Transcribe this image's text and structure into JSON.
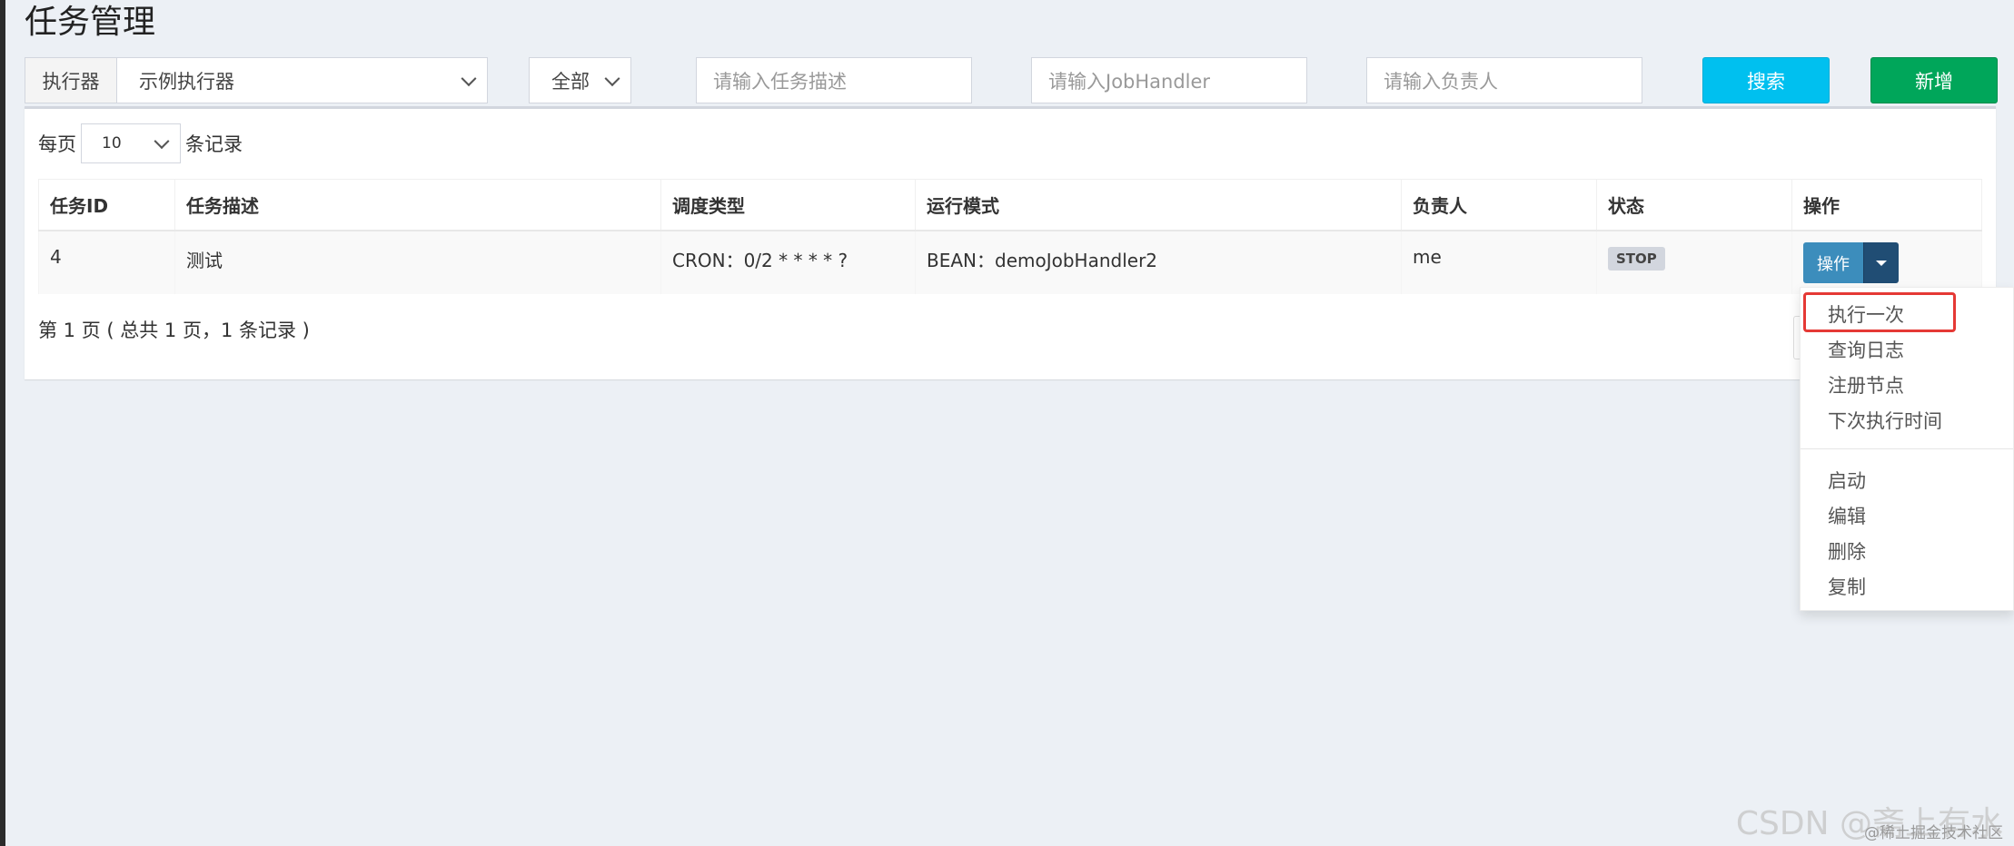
{
  "page_title": "任务管理",
  "filters": {
    "executor_addon": "执行器",
    "executor_value": "示例执行器",
    "status_value": "全部",
    "job_desc_placeholder": "请输入任务描述",
    "handler_placeholder": "请输入JobHandler",
    "author_placeholder": "请输入负责人",
    "search_label": "搜索",
    "add_label": "新增"
  },
  "page_size": {
    "prefix": "每页",
    "value": "10",
    "suffix": "条记录"
  },
  "table": {
    "headers": [
      "任务ID",
      "任务描述",
      "调度类型",
      "运行模式",
      "负责人",
      "状态",
      "操作"
    ],
    "rows": [
      {
        "id": "4",
        "desc": "测试",
        "schedule": "CRON：0/2 * * * * ?",
        "mode": "BEAN：demoJobHandler2",
        "author": "me",
        "status": "STOP",
        "op_label": "操作"
      }
    ]
  },
  "pager_info": "第 1 页 ( 总共 1 页，1 条记录 )",
  "dropdown_menu": {
    "items_top": [
      "执行一次",
      "查询日志",
      "注册节点",
      "下次执行时间"
    ],
    "items_bottom": [
      "启动",
      "编辑",
      "删除",
      "复制"
    ],
    "highlighted": "执行一次"
  },
  "watermark": {
    "main": "CSDN @斋上有水",
    "sub": "@稀土掘金技术社区"
  },
  "colors": {
    "search_button": "#00c0ef",
    "add_button": "#00a65a",
    "op_button": "#3c8dbc",
    "highlight_box": "#e53935"
  }
}
